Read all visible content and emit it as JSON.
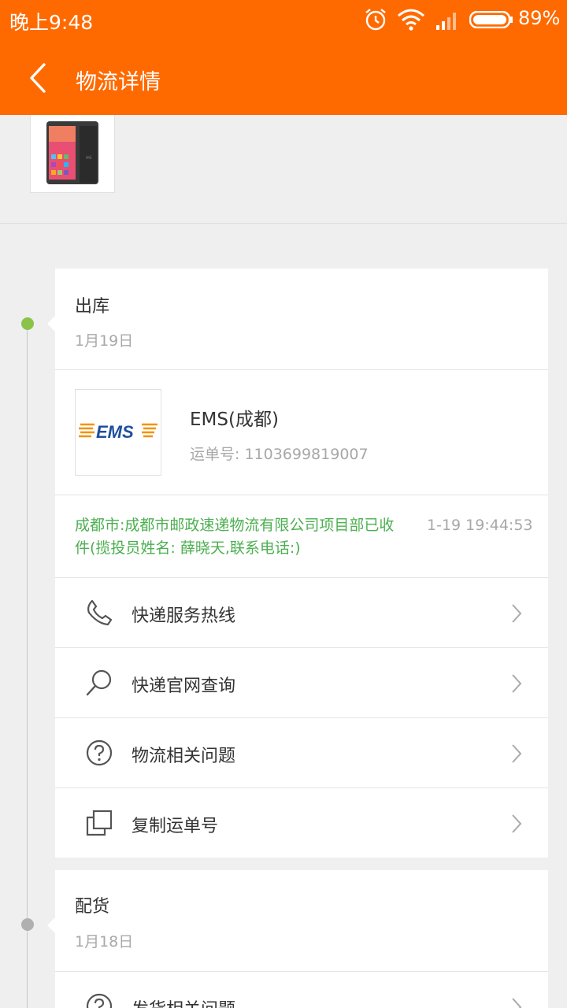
{
  "status_bar": {
    "time": "晚上9:48",
    "battery_percent": "89%",
    "icons": [
      "alarm-icon",
      "wifi-icon",
      "signal-icon",
      "battery-icon"
    ]
  },
  "header": {
    "title": "物流详情",
    "back_icon": "back-arrow-icon"
  },
  "colors": {
    "accent": "#ff6a00",
    "status_green": "#4caf50",
    "timeline_dot_active": "#8bc34a",
    "timeline_dot_inactive": "#b0b0b0"
  },
  "stages": [
    {
      "title": "出库",
      "date": "1月19日",
      "carrier_name": "EMS(成都)",
      "waybill": "运单号: 1103699819007",
      "trace_text": "成都市:成都市邮政速递物流有限公司项目部已收件(揽投员姓名: 薛晓天,联系电话:)",
      "trace_time": "1-19 19:44:53",
      "actions": [
        {
          "label": "快递服务热线",
          "icon": "phone-icon"
        },
        {
          "label": "快递官网查询",
          "icon": "search-icon"
        },
        {
          "label": "物流相关问题",
          "icon": "help-circle-icon"
        },
        {
          "label": "复制运单号",
          "icon": "copy-icon"
        }
      ]
    },
    {
      "title": "配货",
      "date": "1月18日",
      "actions": [
        {
          "label": "发货相关问题",
          "icon": "help-circle-icon"
        }
      ]
    }
  ]
}
